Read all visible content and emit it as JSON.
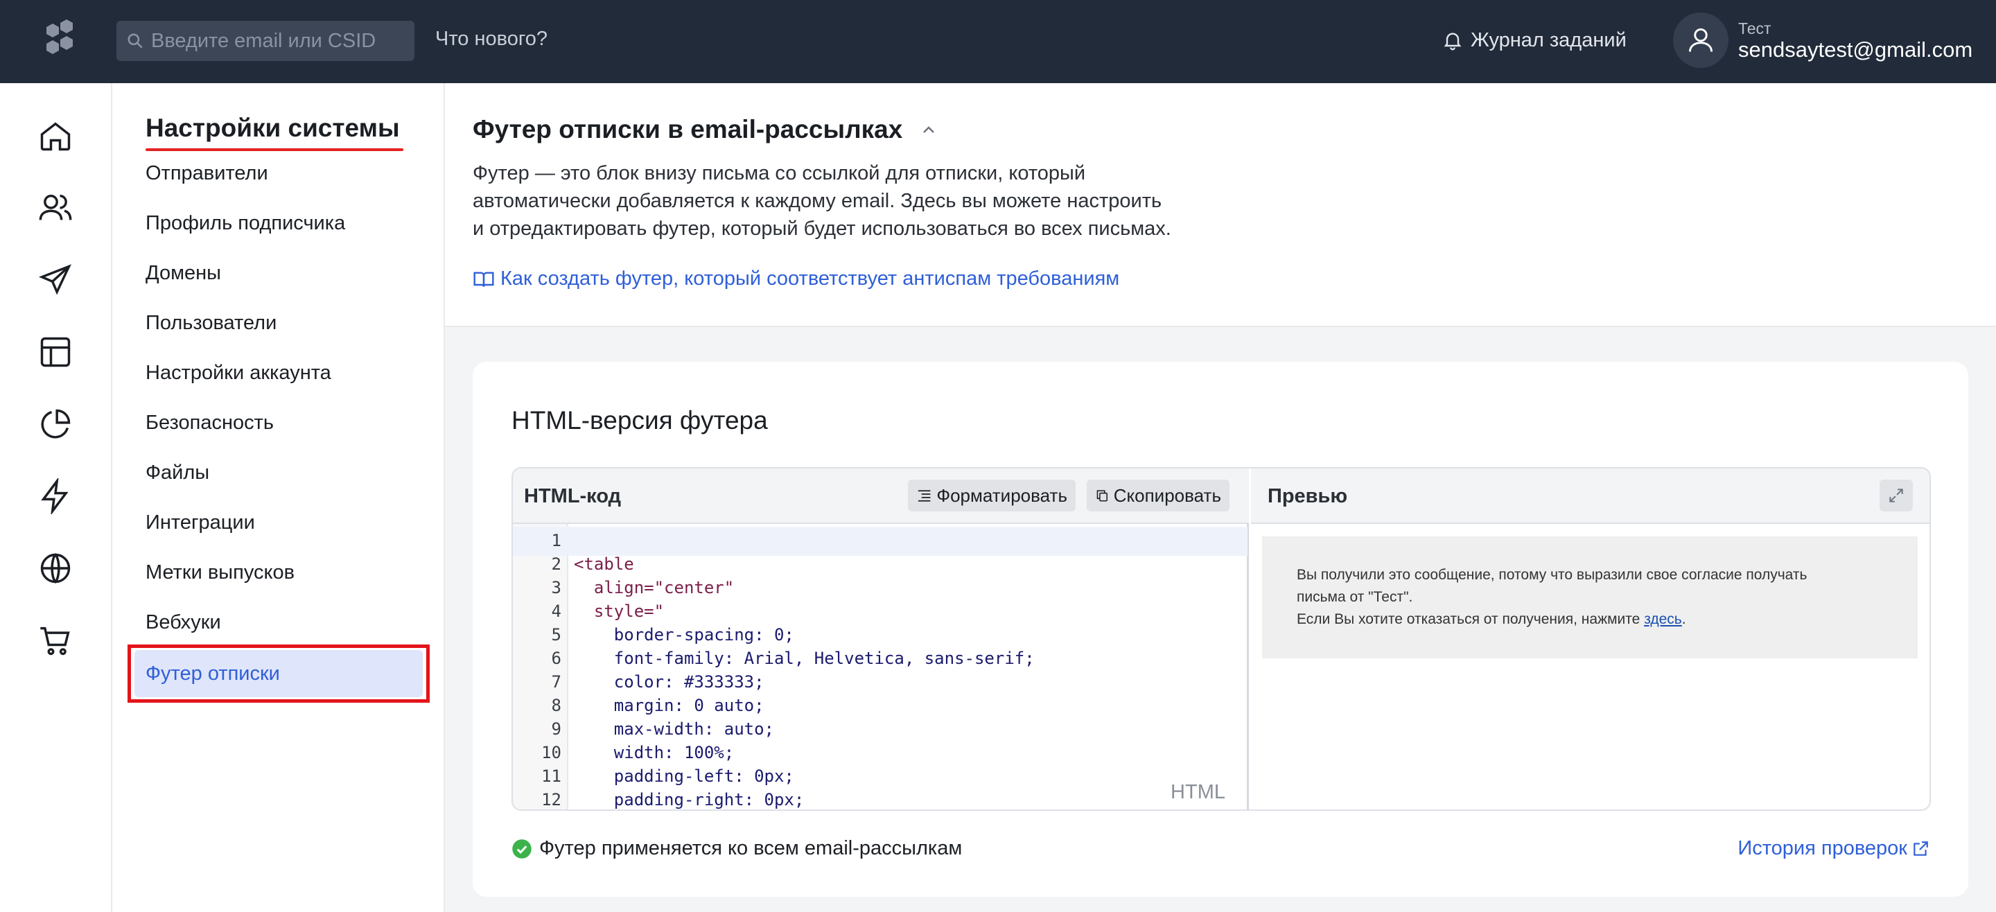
{
  "topbar": {
    "search_placeholder": "Введите email или CSID",
    "whats_new": "Что нового?",
    "journal": "Журнал заданий",
    "user_name": "Тест",
    "user_email": "sendsaytest@gmail.com"
  },
  "rail": {
    "icons": [
      "home-icon",
      "users-icon",
      "send-icon",
      "template-icon",
      "pie-chart-icon",
      "lightning-icon",
      "globe-icon",
      "cart-icon"
    ]
  },
  "nav": {
    "title": "Настройки системы",
    "items": [
      "Отправители",
      "Профиль подписчика",
      "Домены",
      "Пользователи",
      "Настройки аккаунта",
      "Безопасность",
      "Файлы",
      "Интеграции",
      "Метки выпусков",
      "Вебхуки"
    ],
    "active_item": "Футер отписки"
  },
  "header": {
    "title": "Футер отписки в email-рассылках",
    "desc_lines": [
      "Футер — это блок внизу письма со ссылкой для отписки, который",
      "автоматически добавляется к каждому email. Здесь вы можете настроить",
      "и отредактировать футер, который будет использоваться во всех письмах."
    ],
    "link": "Как создать футер, который соответствует антиспам требованиям"
  },
  "card": {
    "title": "HTML-версия футера",
    "code_pane_title": "HTML-код",
    "format_button": "Форматировать",
    "copy_button": "Скопировать",
    "preview_pane_title": "Превью",
    "code_language": "HTML",
    "code_lines": [
      "",
      "<table",
      "  align=\"center\"",
      "  style=\"",
      "    border-spacing: 0;",
      "    font-family: Arial, Helvetica, sans-serif;",
      "    color: #333333;",
      "    margin: 0 auto;",
      "    max-width: auto;",
      "    width: 100%;",
      "    padding-left: 0px;",
      "    padding-right: 0px;"
    ],
    "preview": {
      "line1": "Вы получили это сообщение, потому что выразили свое согласие получать",
      "line2": "письма от \"Тест\".",
      "line3_prefix": "Если Вы хотите отказаться от получения, нажмите ",
      "line3_link": "здесь",
      "line3_suffix": "."
    },
    "status": "Футер применяется ко всем email-рассылкам",
    "history_link": "История проверок"
  },
  "colors": {
    "topbar_bg": "#222b3a",
    "accent_blue": "#2f5fd8",
    "highlight_red": "#e3141a",
    "status_green": "#3bb34a"
  }
}
